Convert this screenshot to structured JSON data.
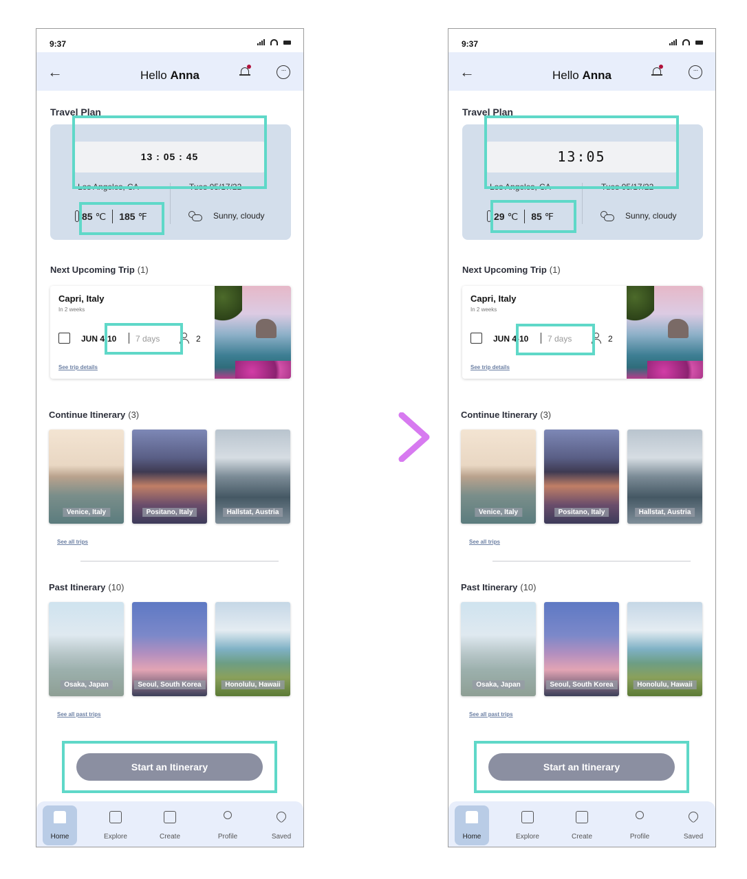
{
  "left": {
    "status_time": "9:37",
    "greeting": "Hello",
    "user": "Anna",
    "travel_plan_title": "Travel Plan",
    "clock": "13 : 05 : 45",
    "location": "Los Angeles, CA",
    "date": "Tues 05/17/22",
    "temp_c": "85",
    "temp_c_unit": "℃",
    "temp_f": "185",
    "temp_f_unit": "℉",
    "weather": "Sunny, cloudy",
    "next_trip_title": "Next Upcoming Trip",
    "next_trip_count": "(1)",
    "trip_name": "Capri, Italy",
    "trip_when": "In 2 weeks",
    "trip_dates": "JUN 4-10",
    "trip_days": "7 days",
    "trip_pax": "2",
    "trip_link": "See trip details",
    "continue_title": "Continue Itinerary",
    "continue_count": "(3)",
    "continue_items": [
      "Venice, Italy",
      "Positano, Italy",
      "Hallstat, Austria"
    ],
    "see_all_trips": "See all trips",
    "past_title": "Past Itinerary",
    "past_count": "(10)",
    "past_items": [
      "Osaka, Japan",
      "Seoul, South Korea",
      "Honolulu, Hawaii"
    ],
    "see_all_past": "See all past trips",
    "cta": "Start an Itinerary",
    "tabs": [
      "Home",
      "Explore",
      "Create",
      "Profile",
      "Saved"
    ]
  },
  "right": {
    "status_time": "9:37",
    "greeting": "Hello",
    "user": "Anna",
    "travel_plan_title": "Travel Plan",
    "clock": "13:05",
    "location": "Los Angeles, CA",
    "date": "Tues 05/17/22",
    "temp_c": "29",
    "temp_c_unit": "℃",
    "temp_f": "85",
    "temp_f_unit": "℉",
    "weather": "Sunny, cloudy",
    "next_trip_title": "Next Upcoming Trip",
    "next_trip_count": "(1)",
    "trip_name": "Capri, Italy",
    "trip_when": "In 2 weeks",
    "trip_dates": "JUN 4-10",
    "trip_days": "7 days",
    "trip_pax": "2",
    "trip_link": "See trip details",
    "continue_title": "Continue Itinerary",
    "continue_count": "(3)",
    "continue_items": [
      "Venice, Italy",
      "Positano, Italy",
      "Hallstat, Austria"
    ],
    "see_all_trips": "See all trips",
    "past_title": "Past Itinerary",
    "past_count": "(10)",
    "past_items": [
      "Osaka, Japan",
      "Seoul, South Korea",
      "Honolulu, Hawaii"
    ],
    "see_all_past": "See all past trips",
    "cta": "Start an Itinerary",
    "tabs": [
      "Home",
      "Explore",
      "Create",
      "Profile",
      "Saved"
    ]
  },
  "colors": {
    "highlight": "#5fd8c8",
    "appbar": "#e8eefb",
    "plan_card": "#d3deeb",
    "cta": "#8b8fa1",
    "arrow_start": "#7fd0f5",
    "arrow_end": "#d77af0"
  }
}
